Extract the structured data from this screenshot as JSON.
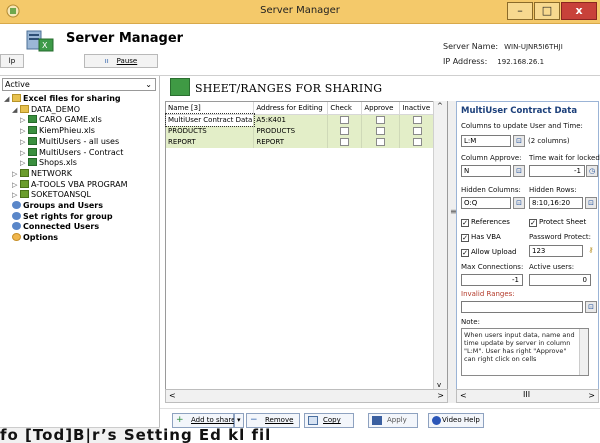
{
  "window": {
    "title": "Server Manager",
    "controls": {
      "minimize": "–",
      "maximize": "□",
      "close": "x"
    }
  },
  "header": {
    "app_name": "Server Manager",
    "help_label": "lp",
    "pause_label": "Pause",
    "server_name_label": "Server Name:",
    "server_name_value": "WIN-UJNR5I6THJI",
    "ip_label": "IP Address:",
    "ip_value": "192.168.26.1"
  },
  "sidebar": {
    "dropdown_value": "Active",
    "tree": [
      {
        "label": "Excel files for sharing",
        "bold": true,
        "indent": 0,
        "exp": "◢",
        "icon": "folder"
      },
      {
        "label": "DATA_DEMO",
        "bold": false,
        "indent": 1,
        "exp": "◢",
        "icon": "folder"
      },
      {
        "label": "CARO GAME.xls",
        "bold": false,
        "indent": 2,
        "exp": "▷",
        "icon": "xls"
      },
      {
        "label": "KiemPhieu.xls",
        "bold": false,
        "indent": 2,
        "exp": "▷",
        "icon": "xls"
      },
      {
        "label": "MultiUsers - all uses",
        "bold": false,
        "indent": 2,
        "exp": "▷",
        "icon": "xls"
      },
      {
        "label": "MultiUsers - Contract",
        "bold": false,
        "indent": 2,
        "exp": "▷",
        "icon": "xls"
      },
      {
        "label": "Shops.xls",
        "bold": false,
        "indent": 2,
        "exp": "▷",
        "icon": "xls"
      },
      {
        "label": "NETWORK",
        "bold": false,
        "indent": 1,
        "exp": "▷",
        "icon": "net"
      },
      {
        "label": "A-TOOLS VBA PROGRAM",
        "bold": false,
        "indent": 1,
        "exp": "▷",
        "icon": "net"
      },
      {
        "label": "SOKETOANSQL",
        "bold": false,
        "indent": 1,
        "exp": "▷",
        "icon": "net"
      },
      {
        "label": "Groups and Users",
        "bold": true,
        "indent": 0,
        "exp": "",
        "icon": "usr"
      },
      {
        "label": "Set rights for group",
        "bold": true,
        "indent": 0,
        "exp": "",
        "icon": "usr"
      },
      {
        "label": "Connected Users",
        "bold": true,
        "indent": 0,
        "exp": "",
        "icon": "usr"
      },
      {
        "label": "Options",
        "bold": true,
        "indent": 0,
        "exp": "",
        "icon": "gear"
      }
    ]
  },
  "main": {
    "section_title": "SHEET/RANGES FOR SHARING",
    "table": {
      "columns": [
        "Name [3]",
        "Address for Editing",
        "Check",
        "Approve",
        "Inactive"
      ],
      "rows": [
        {
          "name": "MultiUser Contract Data",
          "address": "A5:K401",
          "selected": true
        },
        {
          "name": "PRODUCTS",
          "address": "PRODUCTS",
          "selected": false
        },
        {
          "name": "REPORT",
          "address": "REPORT",
          "selected": false
        }
      ]
    }
  },
  "details": {
    "title": "MultiUser Contract Data",
    "columns_update_label": "Columns to update User and Time:",
    "columns_update_value": "L:M",
    "columns_count": "(2 columns)",
    "column_approve_label": "Column Approve:",
    "column_approve_value": "N",
    "time_wait_label": "Time wait for locked:",
    "time_wait_value": "-1",
    "hidden_columns_label": "Hidden Columns:",
    "hidden_columns_value": "O:Q",
    "hidden_rows_label": "Hidden Rows:",
    "hidden_rows_value": "8:10,16:20",
    "references_label": "References",
    "protect_sheet_label": "Protect Sheet",
    "has_vba_label": "Has VBA",
    "password_label": "Password Protect:",
    "password_value": "123",
    "allow_upload_label": "Allow Upload",
    "max_conn_label": "Max Connections:",
    "max_conn_value": "-1",
    "active_users_label": "Active users:",
    "active_users_value": "0",
    "invalid_ranges_label": "Invalid Ranges:",
    "note_label": "Note:",
    "note_text": "When users input data, name and time update by server in column \"L:M\". User has right \"Approve\" can right click on cells"
  },
  "toolbar": {
    "add_label": "Add to share",
    "remove_label": "Remove",
    "copy_label": "Copy",
    "apply_label": "Apply",
    "video_label": "Video Help"
  },
  "status_text": "fo [Tod]B|r’s Setting Ed kl fil"
}
